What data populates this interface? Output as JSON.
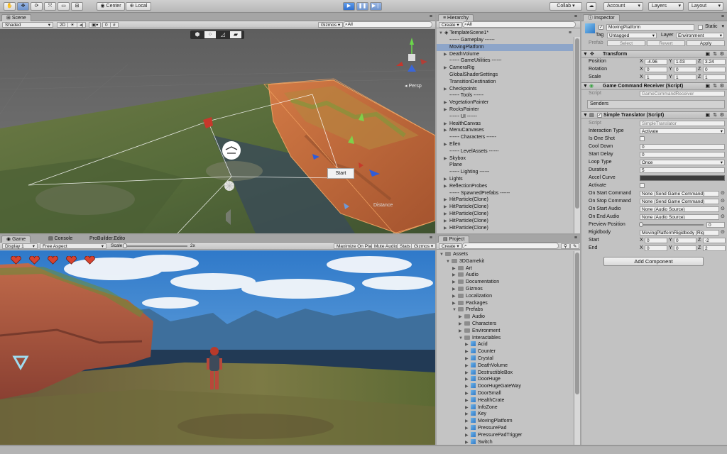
{
  "toolbar": {
    "tools": [
      "hand",
      "move",
      "rotate",
      "scale",
      "rect",
      "transform"
    ],
    "pivot": "Center",
    "space": "Local",
    "collab": "Collab ▾",
    "account": "Account",
    "layers": "Layers",
    "layout": "Layout"
  },
  "scene": {
    "tab": "Scene",
    "shading": "Shaded",
    "mode2d": "2D",
    "gizmos": "Gizmos",
    "search_placeholder": "⌕All",
    "persp": "◂ Persp",
    "start_button": "Start",
    "distance_label": "Distance"
  },
  "game": {
    "tabs": [
      "Game",
      "Console",
      "ProBuilder.Edito"
    ],
    "display": "Display 1",
    "aspect": "Free Aspect",
    "scale_label": "Scale",
    "scale_value": "2x",
    "maximize": "Maximize On Play",
    "mute": "Mute Audio",
    "stats": "Stats",
    "gizmos": "Gizmos",
    "hearts": 5
  },
  "hierarchy": {
    "tab": "Hierarchy",
    "create": "Create",
    "search_placeholder": "⌕All",
    "scene_name": "TemplateScene1*",
    "items": [
      {
        "label": "------ Gameplay ------",
        "arrow": false,
        "selected": false
      },
      {
        "label": "MovingPlatform",
        "arrow": false,
        "selected": true
      },
      {
        "label": "DeathVolume",
        "arrow": true,
        "selected": false
      },
      {
        "label": "------ GameUtilities ------",
        "arrow": false,
        "selected": false
      },
      {
        "label": "CameraRig",
        "arrow": true,
        "selected": false
      },
      {
        "label": "GlobalShaderSettings",
        "arrow": false,
        "selected": false
      },
      {
        "label": "TransitionDestination",
        "arrow": false,
        "selected": false
      },
      {
        "label": "Checkpoints",
        "arrow": true,
        "selected": false
      },
      {
        "label": "------ Tools ------",
        "arrow": false,
        "selected": false
      },
      {
        "label": "VegetationPainter",
        "arrow": true,
        "selected": false
      },
      {
        "label": "RocksPainter",
        "arrow": true,
        "selected": false
      },
      {
        "label": "------ UI ------",
        "arrow": false,
        "selected": false
      },
      {
        "label": "HealthCanvas",
        "arrow": true,
        "selected": false
      },
      {
        "label": "MenuCanvases",
        "arrow": true,
        "selected": false
      },
      {
        "label": "------ Characters ------",
        "arrow": false,
        "selected": false
      },
      {
        "label": "Ellen",
        "arrow": true,
        "selected": false
      },
      {
        "label": "------ LevelAssets ------",
        "arrow": false,
        "selected": false
      },
      {
        "label": "Skybox",
        "arrow": true,
        "selected": false
      },
      {
        "label": "Plane",
        "arrow": false,
        "selected": false
      },
      {
        "label": "------ Lighting ------",
        "arrow": false,
        "selected": false
      },
      {
        "label": "Lights",
        "arrow": true,
        "selected": false
      },
      {
        "label": "ReflectionProbes",
        "arrow": true,
        "selected": false
      },
      {
        "label": "------ SpawnedPrefabs ------",
        "arrow": false,
        "selected": false
      },
      {
        "label": "HitParticle(Clone)",
        "arrow": true,
        "selected": false
      },
      {
        "label": "HitParticle(Clone)",
        "arrow": true,
        "selected": false
      },
      {
        "label": "HitParticle(Clone)",
        "arrow": true,
        "selected": false
      },
      {
        "label": "HitParticle(Clone)",
        "arrow": true,
        "selected": false
      },
      {
        "label": "HitParticle(Clone)",
        "arrow": true,
        "selected": false
      }
    ]
  },
  "project": {
    "tab": "Project",
    "create": "Create",
    "search_placeholder": "⌕",
    "items": [
      {
        "label": "Assets",
        "depth": 0,
        "open": true,
        "kind": "folder"
      },
      {
        "label": "3DGamekit",
        "depth": 1,
        "open": true,
        "kind": "folder"
      },
      {
        "label": "Art",
        "depth": 2,
        "open": false,
        "kind": "folder"
      },
      {
        "label": "Audio",
        "depth": 2,
        "open": false,
        "kind": "folder"
      },
      {
        "label": "Documentation",
        "depth": 2,
        "open": false,
        "kind": "folder"
      },
      {
        "label": "Gizmos",
        "depth": 2,
        "open": false,
        "kind": "folder"
      },
      {
        "label": "Localization",
        "depth": 2,
        "open": false,
        "kind": "folder"
      },
      {
        "label": "Packages",
        "depth": 2,
        "open": false,
        "kind": "folder"
      },
      {
        "label": "Prefabs",
        "depth": 2,
        "open": true,
        "kind": "folder"
      },
      {
        "label": "Audio",
        "depth": 3,
        "open": false,
        "kind": "folder"
      },
      {
        "label": "Characters",
        "depth": 3,
        "open": false,
        "kind": "folder"
      },
      {
        "label": "Environment",
        "depth": 3,
        "open": false,
        "kind": "folder"
      },
      {
        "label": "Interactables",
        "depth": 3,
        "open": true,
        "kind": "folder"
      },
      {
        "label": "Acid",
        "depth": 4,
        "open": false,
        "kind": "prefab"
      },
      {
        "label": "Counter",
        "depth": 4,
        "open": false,
        "kind": "prefab"
      },
      {
        "label": "Crystal",
        "depth": 4,
        "open": false,
        "kind": "prefab"
      },
      {
        "label": "DeathVolume",
        "depth": 4,
        "open": false,
        "kind": "prefab"
      },
      {
        "label": "DestructibleBox",
        "depth": 4,
        "open": false,
        "kind": "prefab"
      },
      {
        "label": "DoorHuge",
        "depth": 4,
        "open": false,
        "kind": "prefab"
      },
      {
        "label": "DoorHugeGateWay",
        "depth": 4,
        "open": false,
        "kind": "prefab"
      },
      {
        "label": "DoorSmall",
        "depth": 4,
        "open": false,
        "kind": "prefab"
      },
      {
        "label": "HealthCrate",
        "depth": 4,
        "open": false,
        "kind": "prefab"
      },
      {
        "label": "InfoZone",
        "depth": 4,
        "open": false,
        "kind": "prefab"
      },
      {
        "label": "Key",
        "depth": 4,
        "open": false,
        "kind": "prefab"
      },
      {
        "label": "MovingPlatform",
        "depth": 4,
        "open": false,
        "kind": "prefab"
      },
      {
        "label": "PressurePad",
        "depth": 4,
        "open": false,
        "kind": "prefab"
      },
      {
        "label": "PressurePadTrigger",
        "depth": 4,
        "open": false,
        "kind": "prefab"
      },
      {
        "label": "Switch",
        "depth": 4,
        "open": false,
        "kind": "prefab"
      }
    ]
  },
  "inspector": {
    "tab": "Inspector",
    "object_name": "MovingPlatform",
    "static_label": "Static",
    "tag_label": "Tag",
    "tag_value": "Untagged",
    "layer_label": "Layer",
    "layer_value": "Environment",
    "prefab_label": "Prefab",
    "prefab_select": "Select",
    "prefab_revert": "Revert",
    "prefab_apply": "Apply",
    "transform": {
      "title": "Transform",
      "rows": [
        {
          "label": "Position",
          "x": "-4.96",
          "y": "1.03",
          "z": "3.24"
        },
        {
          "label": "Rotation",
          "x": "0",
          "y": "0",
          "z": "0"
        },
        {
          "label": "Scale",
          "x": "1",
          "y": "1",
          "z": "1"
        }
      ]
    },
    "gcr": {
      "title": "Game Command Receiver (Script)",
      "script_label": "Script",
      "script_value": "GameCommandReceiver",
      "senders": "Senders"
    },
    "st": {
      "title": "Simple Translator (Script)",
      "script_label": "Script",
      "script_value": "SimpleTranslator",
      "rows": [
        {
          "label": "Interaction Type",
          "value": "Activate",
          "type": "dropdown"
        },
        {
          "label": "Is One Shot",
          "value": "",
          "type": "check"
        },
        {
          "label": "Cool Down",
          "value": "0",
          "type": "text"
        },
        {
          "label": "Start Delay",
          "value": "0",
          "type": "text"
        },
        {
          "label": "Loop Type",
          "value": "Once",
          "type": "dropdown"
        },
        {
          "label": "Duration",
          "value": "5",
          "type": "text"
        },
        {
          "label": "Accel Curve",
          "value": "",
          "type": "curve"
        },
        {
          "label": "Activate",
          "value": "",
          "type": "check"
        },
        {
          "label": "On Start Command",
          "value": "None (Send Game Command)",
          "type": "object"
        },
        {
          "label": "On Stop Command",
          "value": "None (Send Game Command)",
          "type": "object"
        },
        {
          "label": "On Start Audio",
          "value": "None (Audio Source)",
          "type": "object"
        },
        {
          "label": "On End Audio",
          "value": "None (Audio Source)",
          "type": "object"
        },
        {
          "label": "Preview Position",
          "value": "0",
          "type": "slider"
        },
        {
          "label": "Rigidbody",
          "value": "MovingPlatformRigidbody (Rig",
          "type": "object"
        }
      ],
      "start": {
        "label": "Start",
        "x": "0",
        "y": "0",
        "z": "-2"
      },
      "end": {
        "label": "End",
        "x": "0",
        "y": "0",
        "z": "2"
      }
    },
    "add_component": "Add Component"
  }
}
